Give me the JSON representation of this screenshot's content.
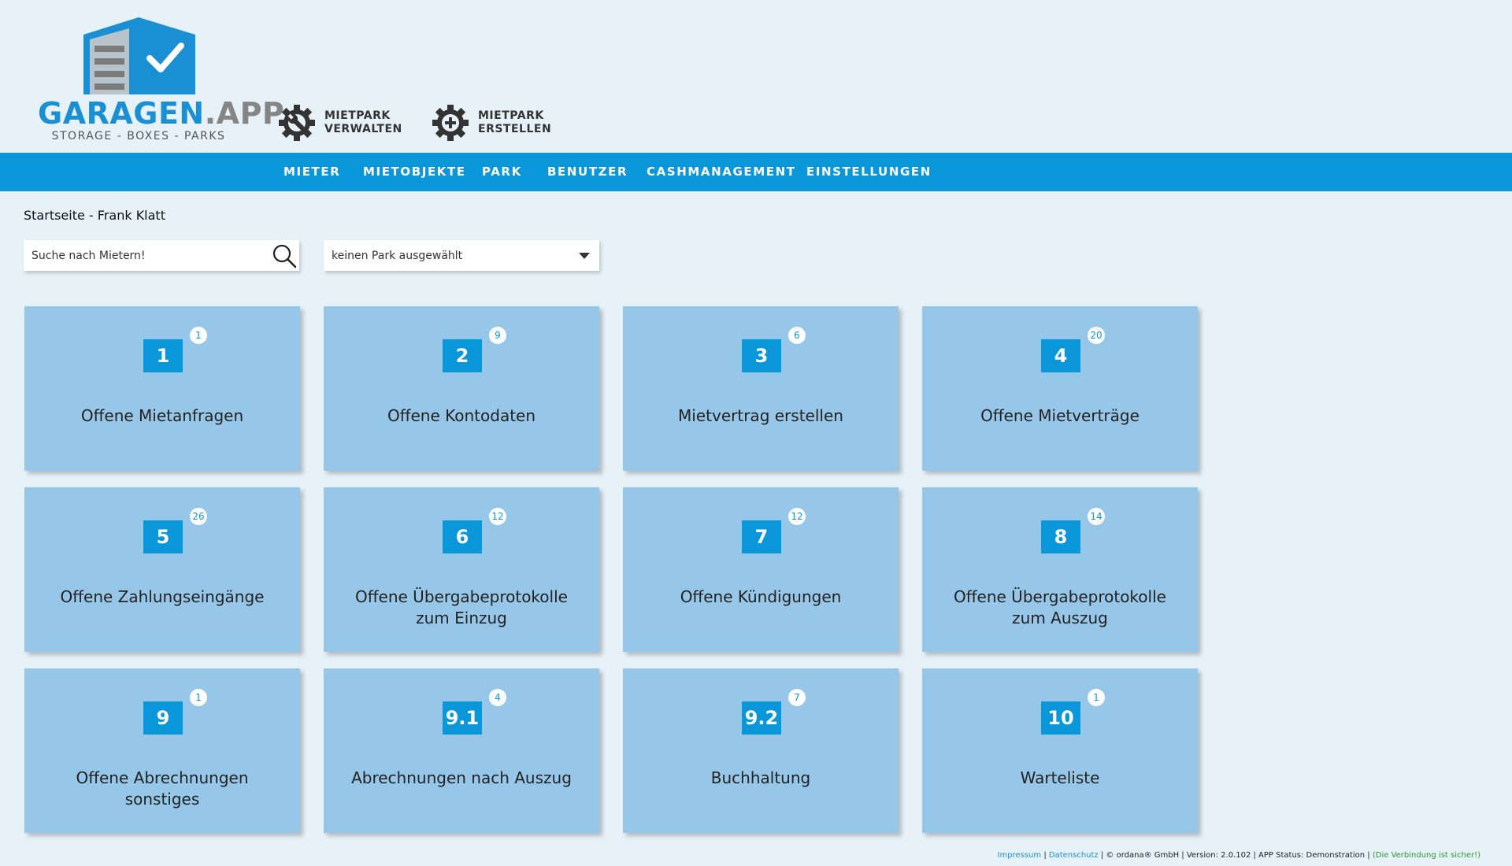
{
  "brand": {
    "word_primary": "GARAGEN",
    "word_secondary": ".APP",
    "tagline": "STORAGE - BOXES - PARKS"
  },
  "header_actions": [
    {
      "line1": "MIETPARK",
      "line2": "VERWALTEN",
      "icon": "gear-wrench-icon"
    },
    {
      "line1": "MIETPARK",
      "line2": "ERSTELLEN",
      "icon": "gear-plus-icon"
    }
  ],
  "nav": [
    "MIETER",
    "MIETOBJEKTE",
    "PARK",
    "BENUTZER",
    "CASHMANAGEMENT",
    "EINSTELLUNGEN"
  ],
  "breadcrumb": "Startseite - Frank Klatt",
  "search": {
    "placeholder": "Suche nach Mietern!"
  },
  "park_select": {
    "value": "keinen Park ausgewählt"
  },
  "tiles": [
    {
      "num": "1",
      "badge": "1",
      "title": "Offene Mietanfragen"
    },
    {
      "num": "2",
      "badge": "9",
      "title": "Offene Kontodaten"
    },
    {
      "num": "3",
      "badge": "6",
      "title": "Mietvertrag erstellen"
    },
    {
      "num": "4",
      "badge": "20",
      "title": "Offene Mietverträge"
    },
    {
      "num": "5",
      "badge": "26",
      "title": "Offene Zahlungseingänge"
    },
    {
      "num": "6",
      "badge": "12",
      "title": "Offene Übergabeprotokolle zum Einzug"
    },
    {
      "num": "7",
      "badge": "12",
      "title": "Offene Kündigungen"
    },
    {
      "num": "8",
      "badge": "14",
      "title": "Offene Übergabeprotokolle zum Auszug"
    },
    {
      "num": "9",
      "badge": "1",
      "title": "Offene Abrechnungen sonstiges"
    },
    {
      "num": "9.1",
      "badge": "4",
      "title": "Abrechnungen nach Auszug"
    },
    {
      "num": "9.2",
      "badge": "7",
      "title": "Buchhaltung"
    },
    {
      "num": "10",
      "badge": "1",
      "title": "Warteliste"
    }
  ],
  "footer": {
    "impressum": "Impressum",
    "sep": " | ",
    "datenschutz": "Datenschutz",
    "info": " | © ordana® GmbH | Version: 2.0.102 | APP Status: Demonstration | ",
    "secure": "(Die Verbindung ist sicher!)"
  },
  "colors": {
    "accent": "#0a97d9",
    "tile": "#96c6e8",
    "background": "#e6f1f8",
    "logo_blue": "#1a8fd4",
    "logo_grey": "#858585"
  }
}
